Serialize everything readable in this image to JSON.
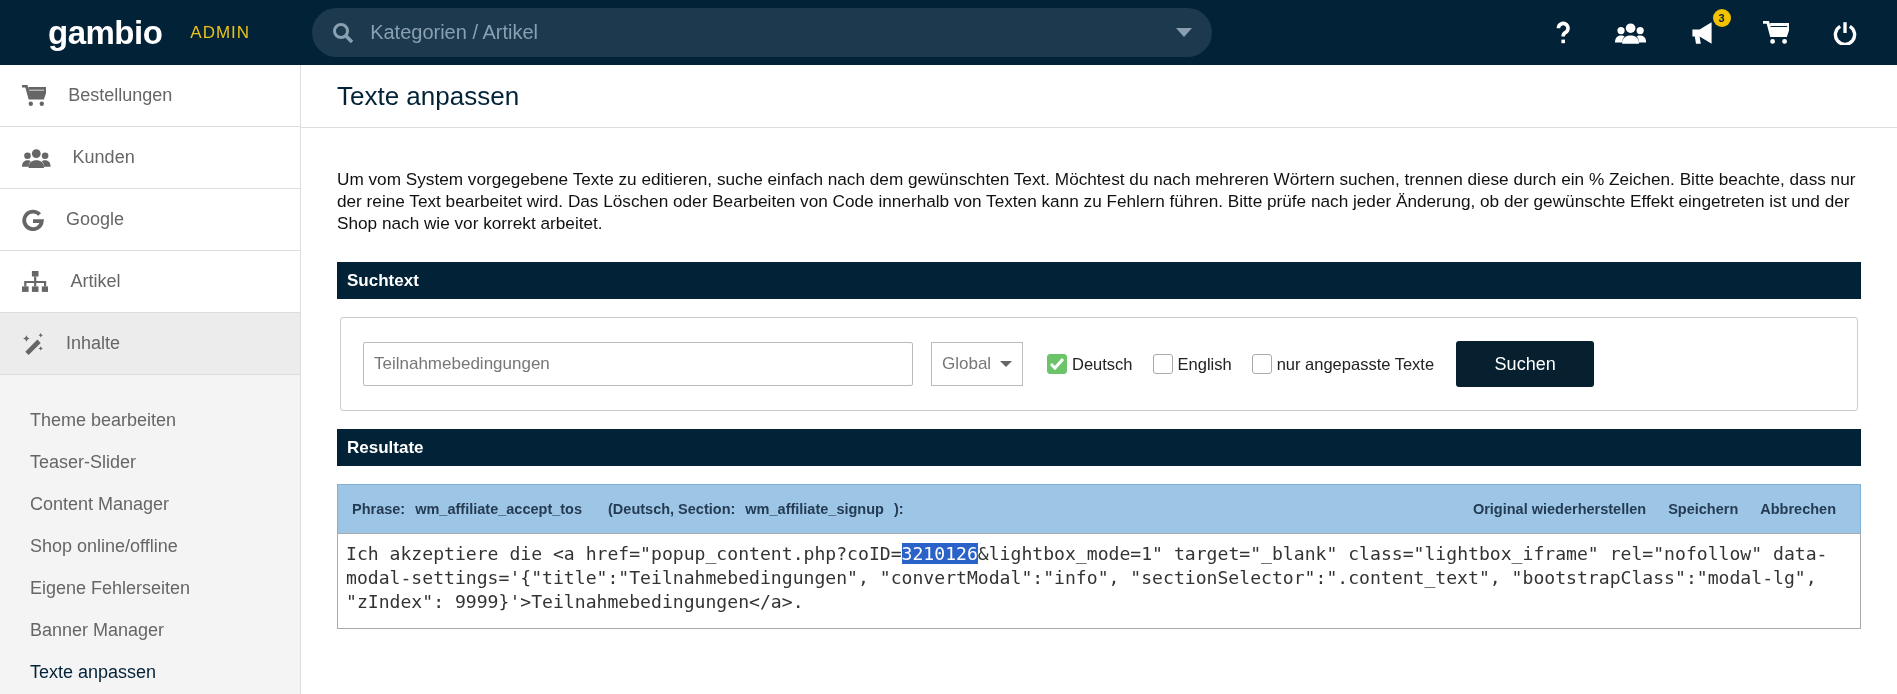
{
  "header": {
    "logo": "gambio",
    "badge_text": "ADMIN",
    "search": {
      "placeholder": "Kategorien / Artikel"
    },
    "icons": [
      {
        "kind": "help"
      },
      {
        "kind": "users"
      },
      {
        "kind": "megaphone",
        "count": "3"
      },
      {
        "kind": "cart"
      },
      {
        "kind": "power"
      }
    ]
  },
  "sidebar": {
    "items": [
      {
        "label": "Bestellungen",
        "kind": "cart",
        "selected": false
      },
      {
        "label": "Kunden",
        "kind": "users",
        "selected": false
      },
      {
        "label": "Google",
        "kind": "google",
        "selected": false
      },
      {
        "label": "Artikel",
        "kind": "sitemap",
        "selected": false
      },
      {
        "label": "Inhalte",
        "kind": "wand",
        "selected": true
      }
    ],
    "subitems": [
      {
        "label": "Theme bearbeiten",
        "selected": false
      },
      {
        "label": "Teaser-Slider",
        "selected": false
      },
      {
        "label": "Content Manager",
        "selected": false
      },
      {
        "label": "Shop online/offline",
        "selected": false
      },
      {
        "label": "Eigene Fehlerseiten",
        "selected": false
      },
      {
        "label": "Banner Manager",
        "selected": false
      },
      {
        "label": "Texte anpassen",
        "selected": true
      }
    ]
  },
  "page": {
    "title": "Texte anpassen",
    "description": "Um vom System vorgegebene Texte zu editieren, suche einfach nach dem gewünschten Text. Möchtest du nach mehreren Wörtern suchen, trennen diese durch ein % Zeichen. Bitte beachte, dass nur der reine Text bearbeitet wird. Das Löschen oder Bearbeiten von Code innerhalb von Texten kann zu Fehlern führen. Bitte prüfe nach jeder Änderung, ob der gewünschte Effekt eingetreten ist und der Shop nach wie vor korrekt arbeitet."
  },
  "search_section": {
    "title": "Suchtext",
    "input": {
      "placeholder": "Teilnahmebedingungen"
    },
    "select": {
      "value": "Global"
    },
    "checkboxes": [
      {
        "label": "Deutsch",
        "checked": true
      },
      {
        "label": "English",
        "checked": false
      },
      {
        "label": "nur angepasste Texte",
        "checked": false
      }
    ],
    "button": "Suchen"
  },
  "results_section": {
    "title": "Resultate",
    "phrase_label": "Phrase:",
    "phrase": "wm_affiliate_accept_tos",
    "section_label": "(Deutsch, Section:",
    "section": "wm_affiliate_signup",
    "closing": "):",
    "actions": [
      "Original wiederherstellen",
      "Speichern",
      "Abbrechen"
    ],
    "editor": {
      "text_before": "Ich akzeptiere die <a href=\"popup_content.php?coID=",
      "selected_text": "3210126",
      "text_after": "&lightbox_mode=1\" target=\"_blank\" class=\"lightbox_iframe\" rel=\"nofollow\" data-modal-settings='{\"title\":\"Teilnahmebedingungen\", \"convertModal\":\"info\", \"sectionSelector\":\".content_text\", \"bootstrapClass\":\"modal-lg\", \"zIndex\": 9999}'>Teilnahmebedingungen</a>."
    }
  }
}
